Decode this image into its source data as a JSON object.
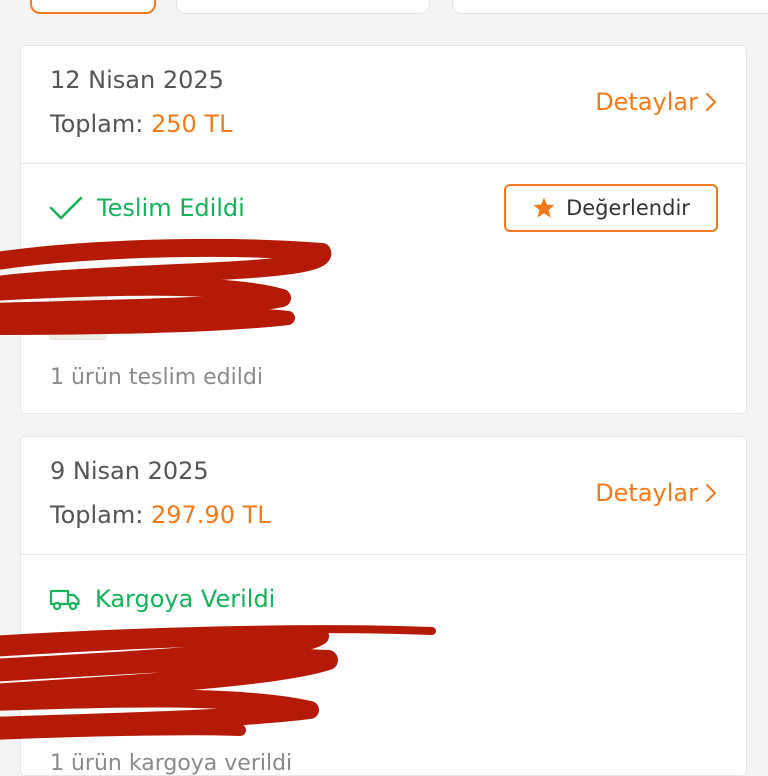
{
  "colors": {
    "accent": "#f27a1a",
    "success": "#14b25a",
    "page_background": "#f4f4f4",
    "card_background": "#ffffff",
    "redaction": "#b41a05"
  },
  "orders": [
    {
      "date": "12 Nisan 2025",
      "total_label": "Toplam:",
      "total_value": "250 TL",
      "details_label": "Detaylar",
      "status_icon": "check-icon",
      "status_label": "Teslim Edildi",
      "action_label": "Değerlendir",
      "action_icon": "star-icon",
      "item_summary": "1 ürün teslim edildi"
    },
    {
      "date": "9 Nisan 2025",
      "total_label": "Toplam:",
      "total_value": "297.90 TL",
      "details_label": "Detaylar",
      "status_icon": "truck-icon",
      "status_label": "Kargoya Verildi",
      "item_summary": "1 ürün kargoya verildi"
    }
  ]
}
